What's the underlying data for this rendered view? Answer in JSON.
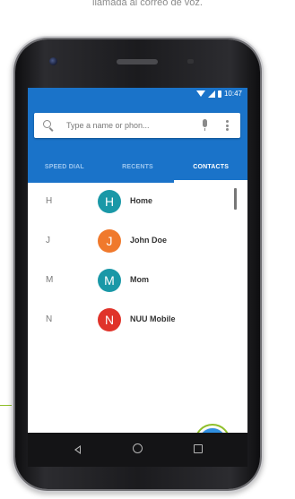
{
  "caption": "llamada al correo de voz.",
  "status_bar": {
    "time": "10:47"
  },
  "search": {
    "placeholder": "Type a name or phon..."
  },
  "tabs": [
    {
      "label": "SPEED DIAL",
      "active": false
    },
    {
      "label": "RECENTS",
      "active": false
    },
    {
      "label": "CONTACTS",
      "active": true
    }
  ],
  "contacts": [
    {
      "letter": "H",
      "initial": "H",
      "name": "Home",
      "color": "#1a98a7"
    },
    {
      "letter": "J",
      "initial": "J",
      "name": "John Doe",
      "color": "#f0792c"
    },
    {
      "letter": "M",
      "initial": "M",
      "name": "Mom",
      "color": "#1a98a7"
    },
    {
      "letter": "N",
      "initial": "N",
      "name": "NUU Mobile",
      "color": "#e0332a"
    }
  ],
  "colors": {
    "primary": "#1a73c9",
    "fab": "#2f8fe0",
    "highlight": "#8fbf2a"
  },
  "icons": {
    "search": "search-icon",
    "mic": "mic-icon",
    "overflow": "more-vert-icon",
    "fab": "dialpad-icon",
    "nav": [
      "back-icon",
      "home-icon",
      "recents-icon"
    ]
  }
}
